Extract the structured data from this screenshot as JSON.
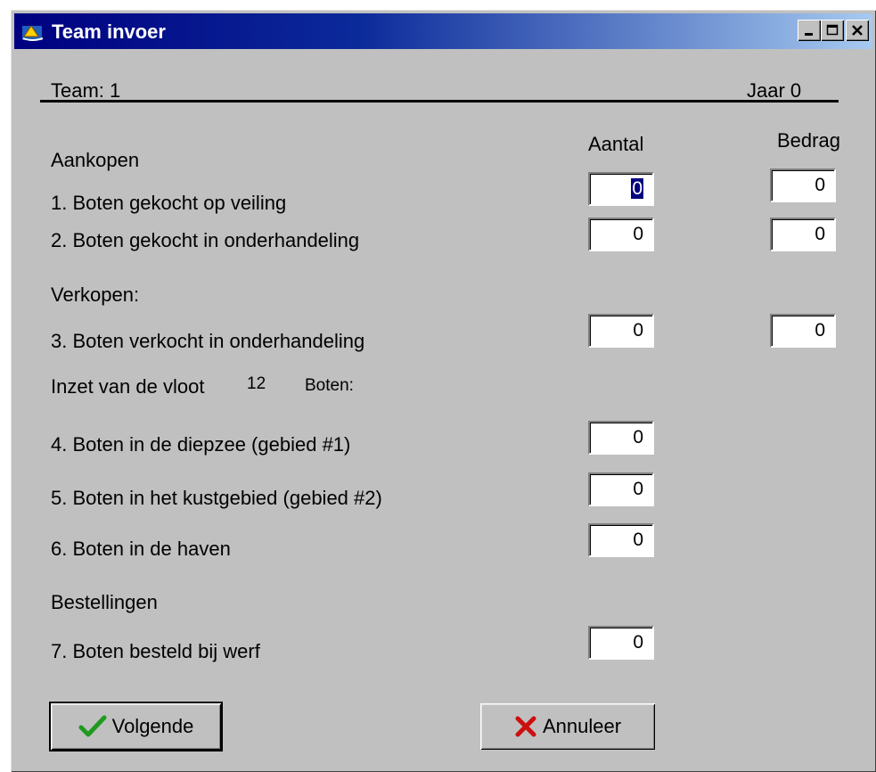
{
  "window": {
    "title": "Team invoer",
    "icon": "app-icon",
    "controls": [
      "minimize-icon",
      "maximize-icon",
      "close-icon"
    ]
  },
  "header": {
    "team": "Team: 1",
    "year": "Jaar 0"
  },
  "columns": {
    "aantal": "Aantal",
    "bedrag": "Bedrag"
  },
  "sections": {
    "aankopen": "Aankopen",
    "verkopen": "Verkopen:",
    "inzet_label": "Inzet van de vloot",
    "inzet_count": "12",
    "inzet_unit": "Boten:",
    "bestellingen": "Bestellingen"
  },
  "rows": {
    "r1": {
      "label": "1. Boten gekocht op veiling",
      "aantal": "0",
      "bedrag": "0"
    },
    "r2": {
      "label": "2. Boten gekocht in onderhandeling",
      "aantal": "0",
      "bedrag": "0"
    },
    "r3": {
      "label": "3. Boten verkocht in onderhandeling",
      "aantal": "0",
      "bedrag": "0"
    },
    "r4": {
      "label": "4. Boten in de diepzee (gebied #1)",
      "aantal": "0"
    },
    "r5": {
      "label": "5. Boten in het kustgebied (gebied #2)",
      "aantal": "0"
    },
    "r6": {
      "label": "6. Boten in de haven",
      "aantal": "0"
    },
    "r7": {
      "label": "7. Boten besteld bij werf",
      "aantal": "0"
    }
  },
  "buttons": {
    "next": "Volgende",
    "cancel": "Annuleer"
  },
  "colors": {
    "titlebar_start": "#000080",
    "titlebar_end": "#a6caf0",
    "face": "#c0c0c0",
    "check": "#1f9a1f",
    "cross": "#cc1010"
  }
}
